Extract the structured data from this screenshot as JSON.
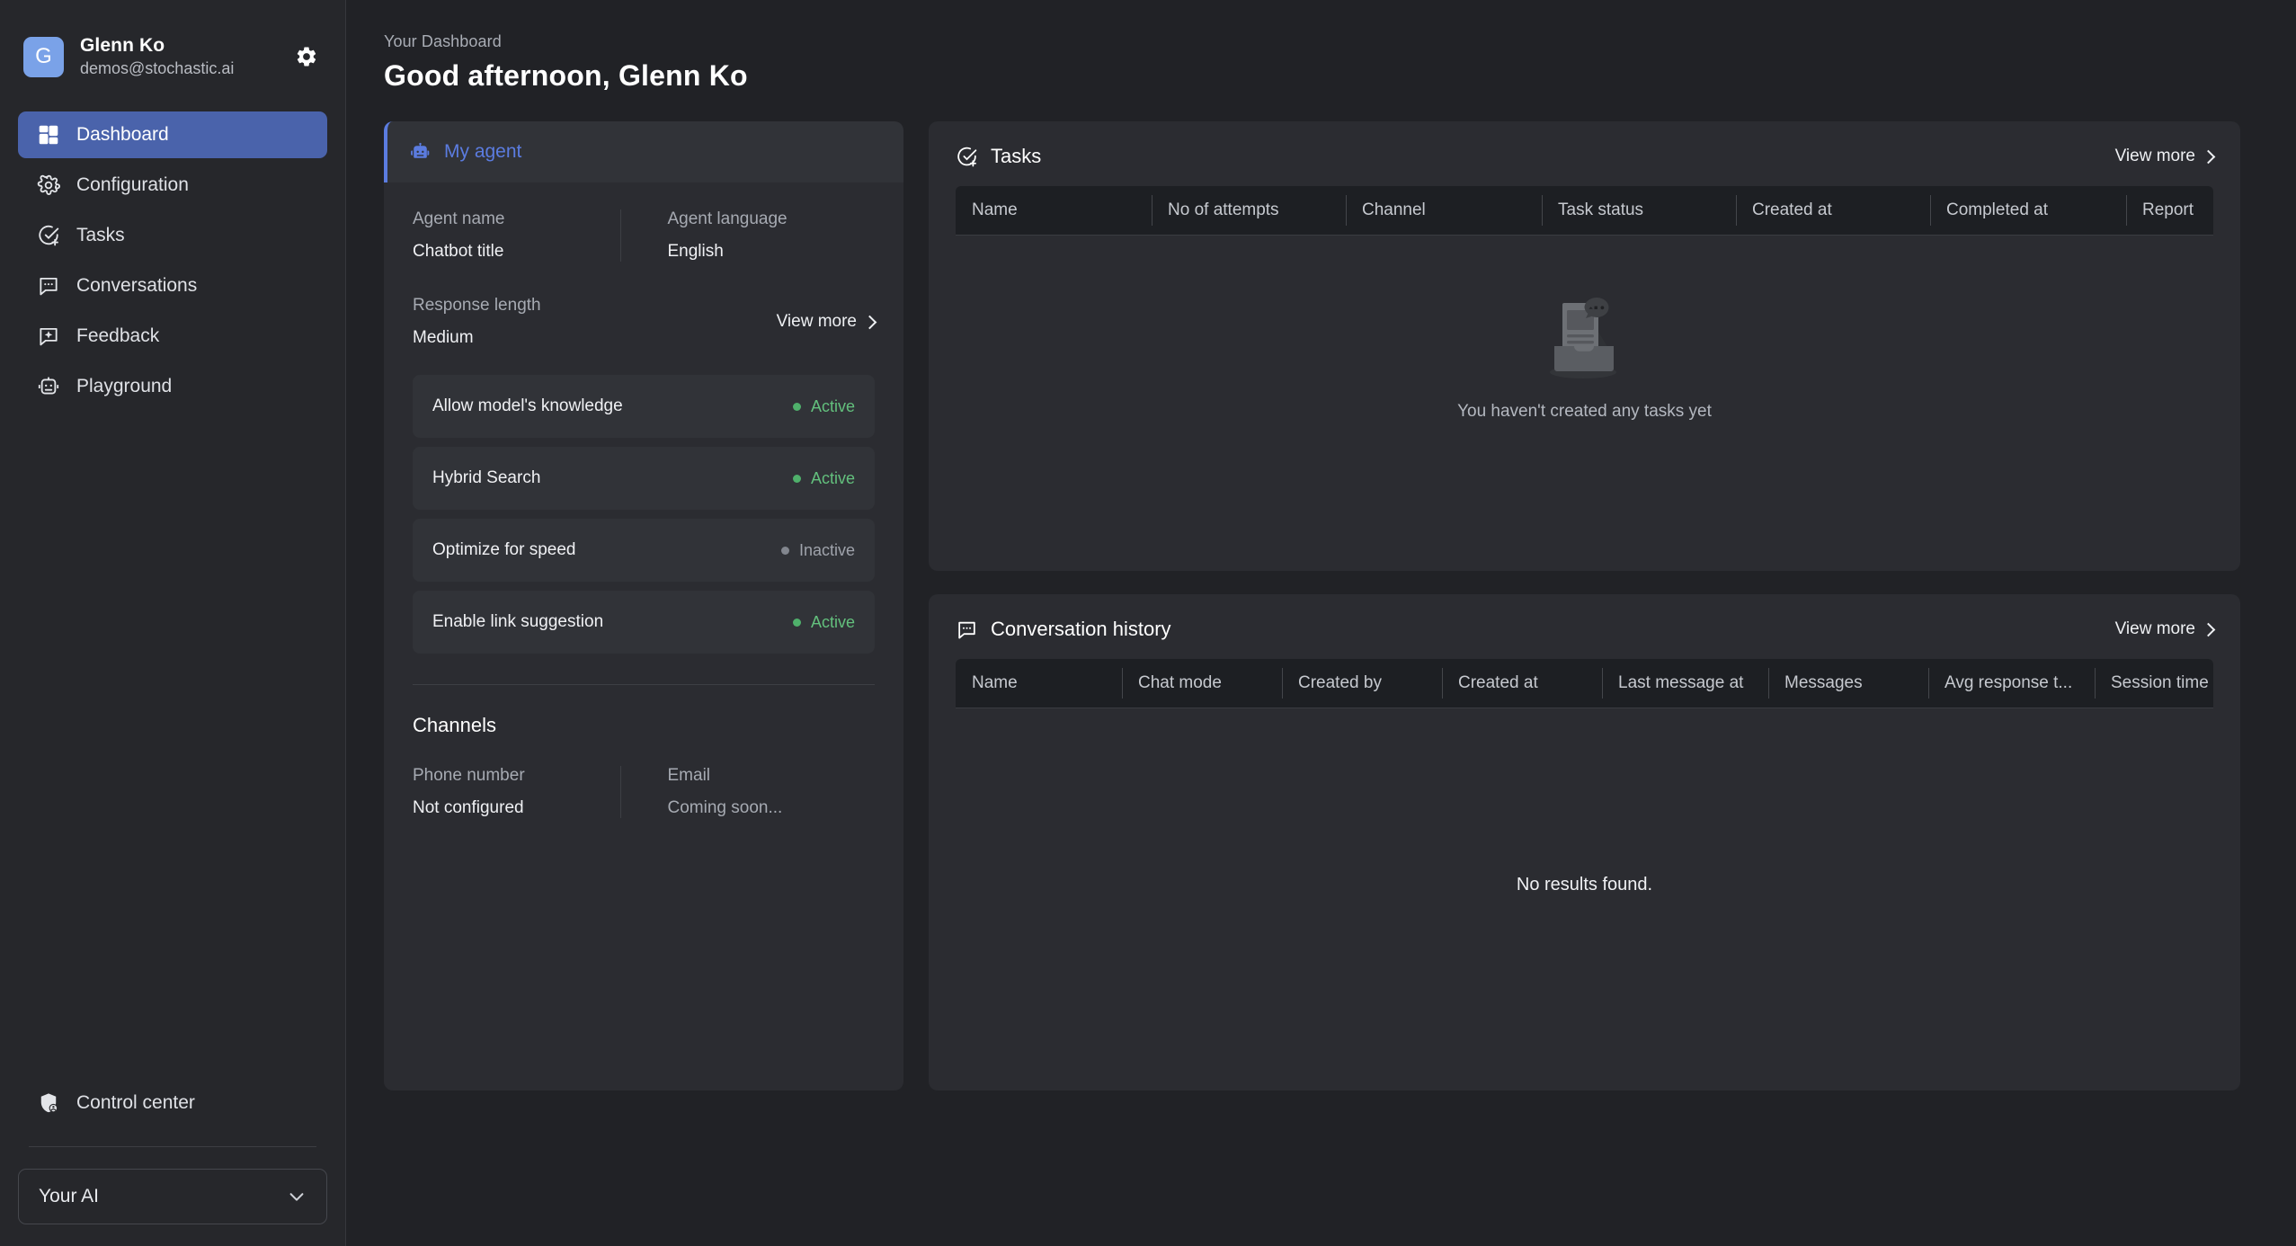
{
  "sidebar": {
    "profile": {
      "avatar_initial": "G",
      "name": "Glenn Ko",
      "email": "demos@stochastic.ai",
      "settings_icon": "gear-icon"
    },
    "items": [
      {
        "label": "Dashboard",
        "icon": "dashboard-grid-icon",
        "active": true
      },
      {
        "label": "Configuration",
        "icon": "gear-icon",
        "active": false
      },
      {
        "label": "Tasks",
        "icon": "check-circle-plus-icon",
        "active": false
      },
      {
        "label": "Conversations",
        "icon": "chat-dots-icon",
        "active": false
      },
      {
        "label": "Feedback",
        "icon": "chat-sparkle-icon",
        "active": false
      },
      {
        "label": "Playground",
        "icon": "robot-icon",
        "active": false
      }
    ],
    "control_center": {
      "label": "Control center",
      "icon": "shield-user-icon"
    },
    "workspace_select": {
      "value": "Your AI",
      "icon": "chevron-down-icon"
    }
  },
  "header": {
    "breadcrumb": "Your Dashboard",
    "greeting": "Good afternoon, Glenn Ko"
  },
  "agent_card": {
    "title": "My agent",
    "icon": "robot-icon",
    "accent_color": "#5b7ce0",
    "fields": [
      {
        "label": "Agent name",
        "value": "Chatbot title"
      },
      {
        "label": "Agent language",
        "value": "English"
      },
      {
        "label": "Response length",
        "value": "Medium"
      }
    ],
    "view_more_label": "View more",
    "features": [
      {
        "name": "Allow model's knowledge",
        "status": "Active",
        "state": "active"
      },
      {
        "name": "Hybrid Search",
        "status": "Active",
        "state": "active"
      },
      {
        "name": "Optimize for speed",
        "status": "Inactive",
        "state": "inactive"
      },
      {
        "name": "Enable link suggestion",
        "status": "Active",
        "state": "active"
      }
    ],
    "channels": {
      "title": "Channels",
      "items": [
        {
          "label": "Phone number",
          "value": "Not configured"
        },
        {
          "label": "Email",
          "value": "Coming soon..."
        }
      ]
    },
    "status_colors": {
      "active": "#4fb06b",
      "inactive": "#82868e"
    }
  },
  "tasks_panel": {
    "title": "Tasks",
    "icon": "check-circle-plus-icon",
    "view_more_label": "View more",
    "columns": [
      "Name",
      "No of attempts",
      "Channel",
      "Task status",
      "Created at",
      "Completed at",
      "Report"
    ],
    "empty_message": "You haven't created any tasks yet",
    "rows": []
  },
  "conversation_panel": {
    "title": "Conversation history",
    "icon": "chat-dots-icon",
    "view_more_label": "View more",
    "columns": [
      "Name",
      "Chat mode",
      "Created by",
      "Created at",
      "Last message at",
      "Messages",
      "Avg response t...",
      "Session time"
    ],
    "empty_message": "No results found.",
    "rows": []
  },
  "theme": {
    "page_bg": "#212226",
    "sidebar_bg": "#26272b",
    "card_bg": "#2b2c31",
    "row_bg": "#313338",
    "table_header_bg": "#1d1f23",
    "accent": "#4a63ab",
    "link_blue": "#5b7ce0"
  }
}
